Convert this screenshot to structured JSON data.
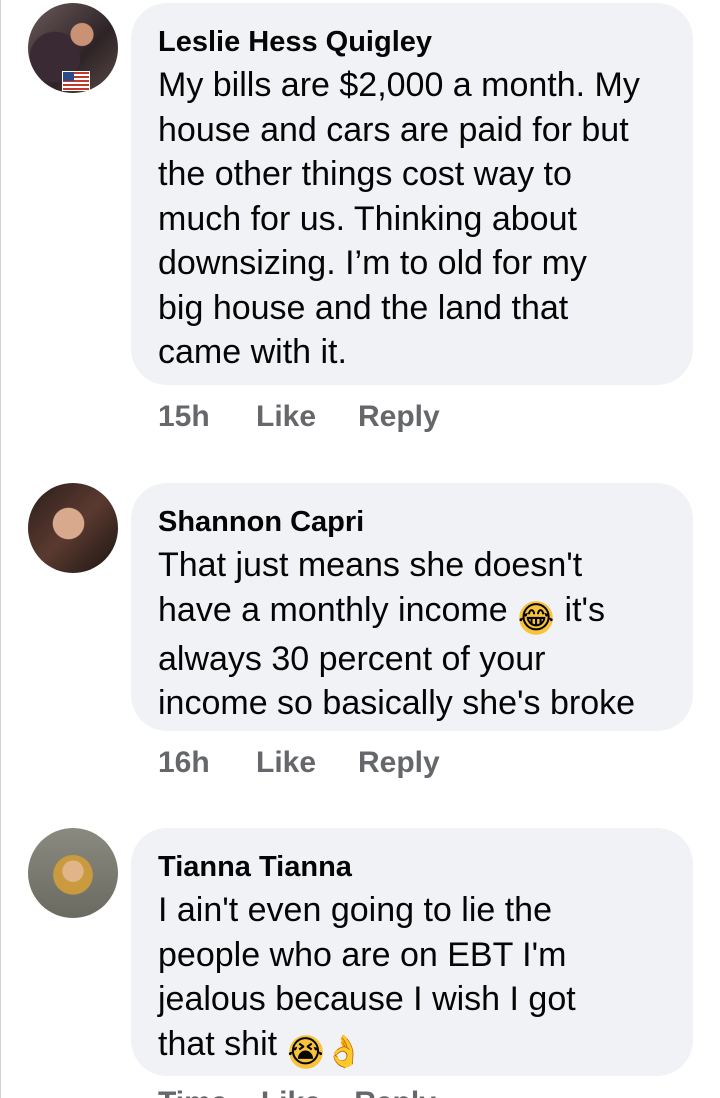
{
  "comments": [
    {
      "author": "Leslie Hess Quigley",
      "lines": [
        "My bills are $2,000 a month. My",
        "house and cars are paid for but",
        "the other things cost way to",
        "much for us. Thinking about",
        "downsizing. I’m to old for my",
        "big house and the land that",
        "came with it."
      ],
      "time": "15h",
      "like": "Like",
      "reply": "Reply"
    },
    {
      "author": "Shannon Capri",
      "lines": [
        "That just means she doesn't",
        "have a monthly income",
        "it's",
        "always 30 percent of your",
        "income so basically she's broke"
      ],
      "emoji_1": "😂",
      "time": "16h",
      "like": "Like",
      "reply": "Reply"
    },
    {
      "author": "Tianna Tianna",
      "lines": [
        "I ain't even going to lie the",
        "people who are on EBT I'm",
        "jealous because I wish I got",
        "that shit"
      ],
      "emoji_1": "😭",
      "emoji_2": "👌",
      "time": "Time",
      "like": "Like",
      "reply": "Reply"
    }
  ],
  "icons": {
    "emoji_tears_of_joy": "face-with-tears-of-joy-icon",
    "emoji_crying": "loudly-crying-face-icon",
    "emoji_ok_hand": "ok-hand-icon"
  },
  "colors": {
    "bubble": "#f0f2f5",
    "text": "#050505",
    "meta": "#65676b"
  }
}
